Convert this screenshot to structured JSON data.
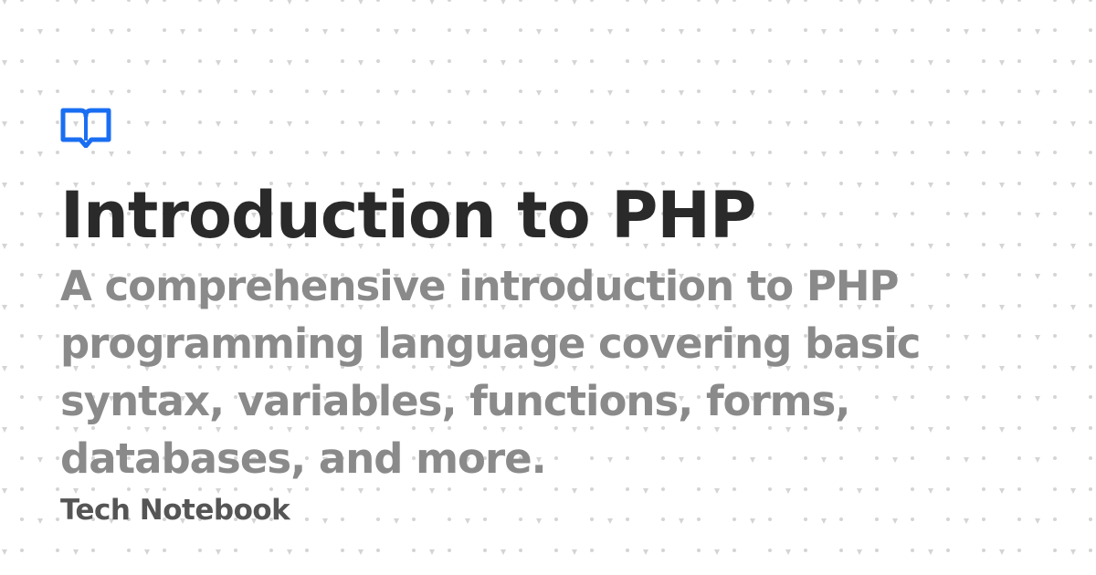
{
  "card": {
    "title": "Introduction to PHP",
    "description": "A comprehensive introduction to PHP programming language covering basic syntax, variables, functions, forms, databases, and more.",
    "site_name": "Tech Notebook"
  },
  "logo": {
    "icon": "book-icon",
    "color": "#1a6ef2"
  },
  "colors": {
    "background": "#ffffff",
    "pattern": "#d6d6d6",
    "title": "#2a2a2a",
    "description": "#8a8a8a",
    "site_name": "#555555"
  }
}
